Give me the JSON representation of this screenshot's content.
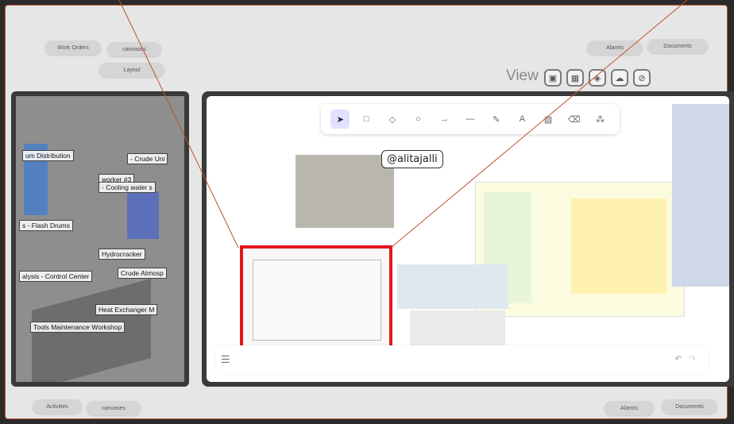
{
  "top_left": {
    "work_orders": "Work Orders",
    "canvases": "canvases",
    "layout": "Layout"
  },
  "top_right": {
    "alarms": "Alarms",
    "documents": "Documents"
  },
  "view": {
    "label": "View :"
  },
  "scene_labels": [
    "um Distribution",
    "- Crude Uni",
    "worker #3",
    "- Cooling water s",
    "s - Flash Drums",
    "Hydrocracker",
    "alysis - Control Center",
    "Crude Atmosp",
    "Heat Exchanger M",
    "Tools Maintenance Workshop"
  ],
  "canvas": {
    "handle": "@alitajalli"
  },
  "bottom_left": {
    "activities": "Activities",
    "canvases": "canvases"
  },
  "bottom_right": {
    "alarms": "Alarms",
    "documents": "Documents"
  },
  "colors": {
    "selection": "#e3161b",
    "annotation_line": "#c0502c",
    "frame_bg": "#e6e6e6"
  }
}
